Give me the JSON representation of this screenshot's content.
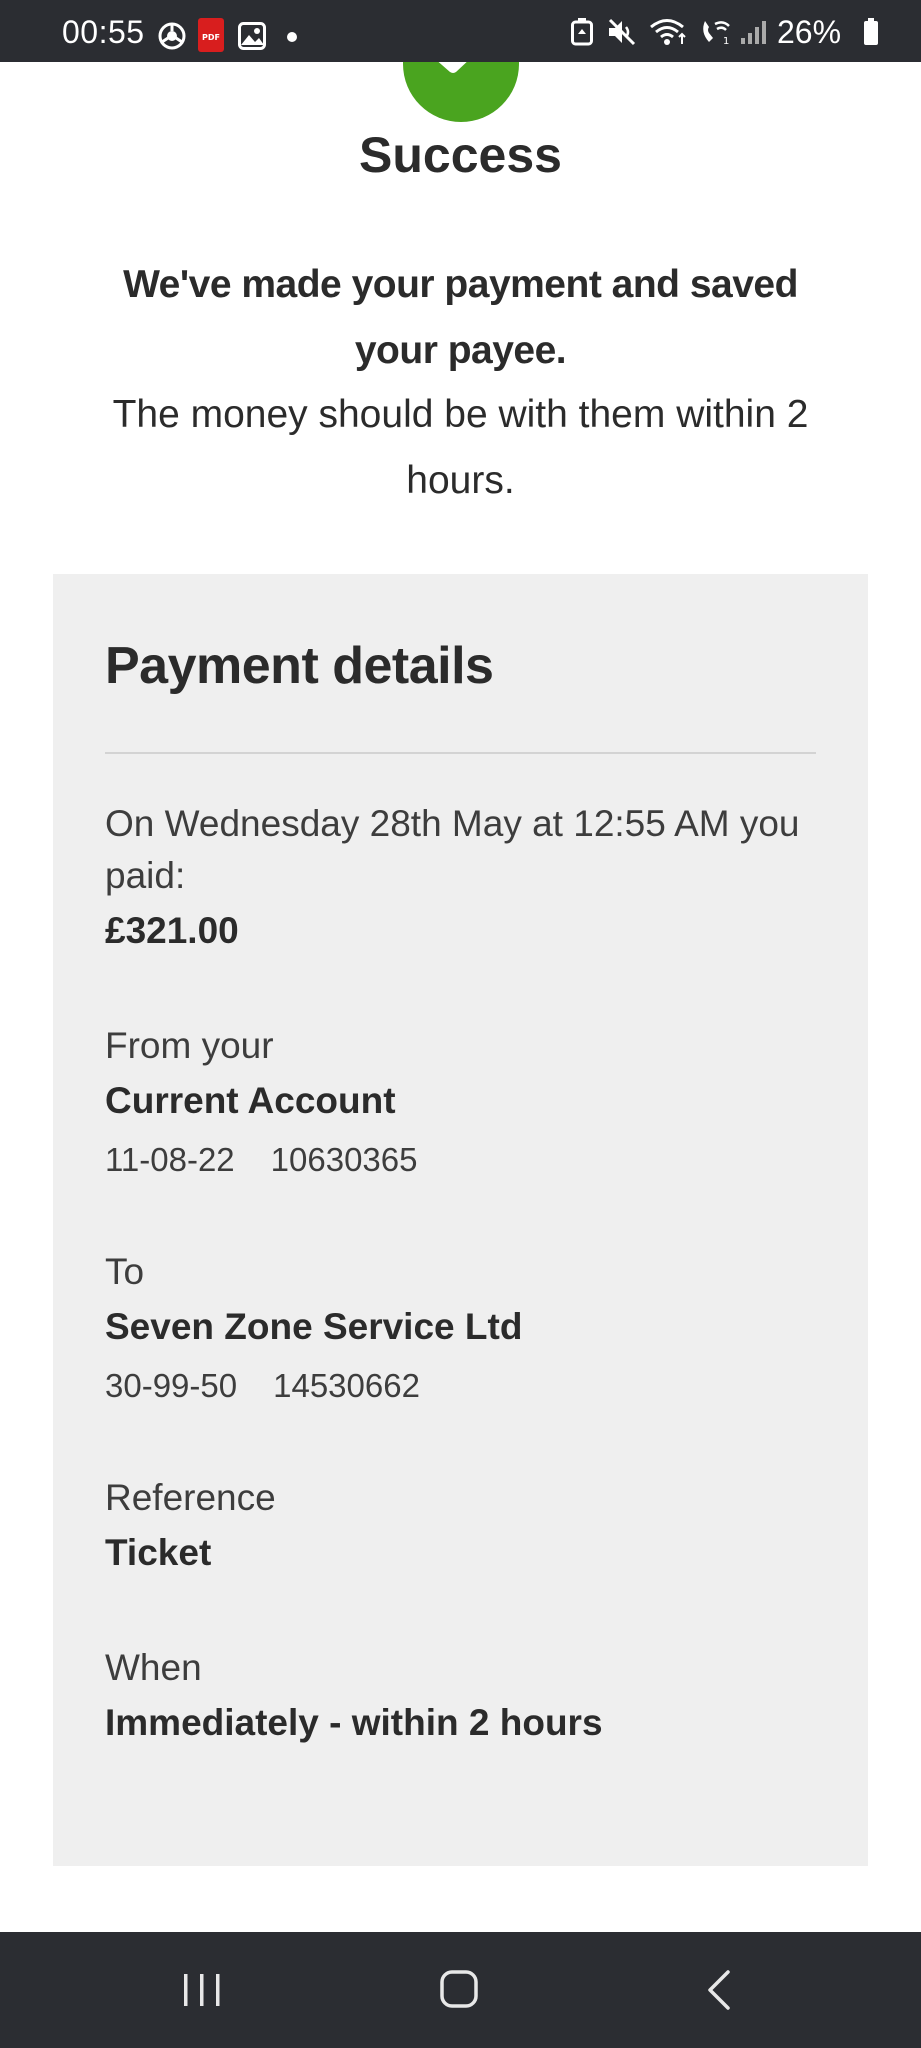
{
  "status_bar": {
    "time": "00:55",
    "battery": "26%",
    "left_icons": [
      "chrome-icon",
      "pdf-icon",
      "gallery-icon",
      "dot-icon"
    ],
    "right_icons": [
      "recycle-icon",
      "mute-icon",
      "wifi-icon",
      "wifi-calling-icon",
      "signal-icon",
      "battery-icon"
    ]
  },
  "header": {
    "title": "Success",
    "message_strong": "We've made your payment and saved your payee.",
    "message_light": "The money should be with them within 2 hours."
  },
  "details": {
    "title": "Payment details",
    "paid_label": "On Wednesday 28th May at 12:55 AM you paid:",
    "amount": "£321.00",
    "from_label": "From your",
    "from_account": "Current Account",
    "from_sort_code": "11-08-22",
    "from_account_number": "10630365",
    "to_label": "To",
    "to_name": "Seven Zone Service Ltd",
    "to_sort_code": "30-99-50",
    "to_account_number": "14530662",
    "reference_label": "Reference",
    "reference_value": "Ticket",
    "when_label": "When",
    "when_value": "Immediately - within 2 hours"
  },
  "nav": {
    "buttons": [
      "recent-apps",
      "home",
      "back"
    ]
  },
  "colors": {
    "status_bar_bg": "#2b2d32",
    "success_green": "#4aa41f",
    "panel_bg": "#efefef",
    "text": "#2b2b2b"
  }
}
